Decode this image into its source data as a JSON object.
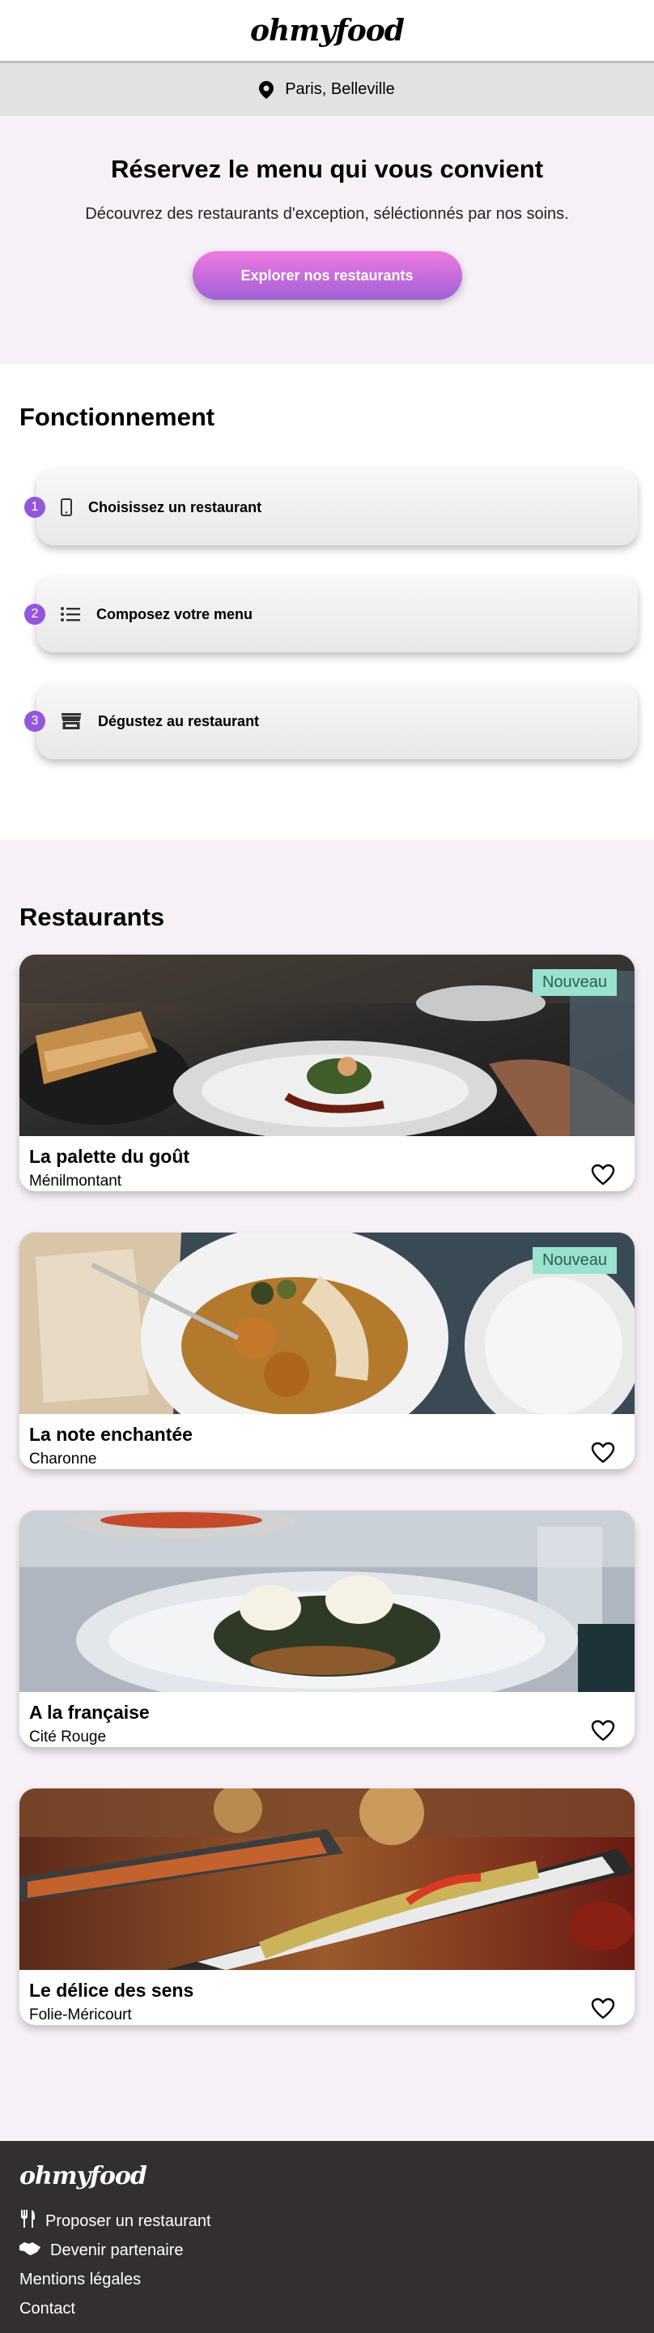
{
  "header": {
    "logo": "ohmyfood"
  },
  "location": {
    "text": "Paris, Belleville"
  },
  "hero": {
    "title": "Réservez le menu qui vous convient",
    "subtitle": "Découvrez des restaurants d'exception, séléctionnés par nos soins.",
    "cta": "Explorer nos restaurants"
  },
  "how": {
    "title": "Fonctionnement",
    "steps": [
      {
        "number": "1",
        "label": "Choisissez un restaurant",
        "icon": "mobile-phone-icon"
      },
      {
        "number": "2",
        "label": "Composez votre menu",
        "icon": "list-icon"
      },
      {
        "number": "3",
        "label": "Dégustez au restaurant",
        "icon": "store-icon"
      }
    ]
  },
  "restaurants": {
    "title": "Restaurants",
    "items": [
      {
        "name": "La palette du goût",
        "area": "Ménilmontant",
        "badge": "Nouveau"
      },
      {
        "name": "La note enchantée",
        "area": "Charonne",
        "badge": "Nouveau"
      },
      {
        "name": "A la française",
        "area": "Cité Rouge"
      },
      {
        "name": "Le délice des sens",
        "area": "Folie-Méricourt"
      }
    ]
  },
  "footer": {
    "logo": "ohmyfood",
    "links": [
      {
        "label": "Proposer un restaurant",
        "icon": "utensils-icon"
      },
      {
        "label": "Devenir partenaire",
        "icon": "handshake-icon"
      },
      {
        "label": "Mentions légales"
      },
      {
        "label": "Contact"
      }
    ]
  },
  "colors": {
    "accent": "#9356dc",
    "cta_top": "#ee7ae2",
    "cta_bottom": "#a160d6",
    "badge": "#99e2d0",
    "footer": "#332f2f"
  }
}
